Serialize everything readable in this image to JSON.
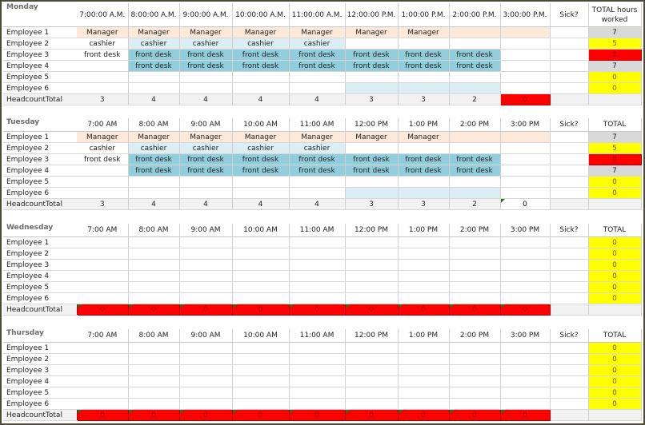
{
  "colors": {
    "mgr": "#fde9d9",
    "cash": "#daeef3",
    "fd": "#92cddc",
    "gray": "#d9d9d9",
    "yellow": "#ffff00",
    "red": "#ff0000"
  },
  "days": [
    {
      "title": "Monday",
      "times": [
        "7:00:00 A.M.",
        "8:00:00 A.M.",
        "9:00:00 A.M.",
        "10:00:00 A.M.",
        "11:00:00 A.M.",
        "12:00:00 P.M.",
        "1:00:00 P.M.",
        "2:00:00 P.M.",
        "3:00:00 P.M."
      ],
      "sick_label": "Sick?",
      "total_label": "TOTAL hours worked",
      "rows": [
        {
          "name": "Employee 1",
          "cells": [
            [
              "Manager",
              "mgr"
            ],
            [
              "Manager",
              "mgr"
            ],
            [
              "Manager",
              "mgr"
            ],
            [
              "Manager",
              "mgr"
            ],
            [
              "Manager",
              "mgr"
            ],
            [
              "Manager",
              "mgr"
            ],
            [
              "Manager",
              "mgr"
            ],
            [
              "",
              "mgr"
            ],
            [
              "",
              "mgr"
            ]
          ],
          "total": "7",
          "total_fill": "gray"
        },
        {
          "name": "Employee 2",
          "cells": [
            [
              "cashier",
              ""
            ],
            [
              "cashier",
              "cash"
            ],
            [
              "cashier",
              "cash"
            ],
            [
              "cashier",
              "cash"
            ],
            [
              "cashier",
              "cash"
            ],
            [
              "",
              ""
            ],
            [
              "",
              ""
            ],
            [
              "",
              ""
            ],
            [
              "",
              ""
            ]
          ],
          "total": "5",
          "total_fill": "yellow"
        },
        {
          "name": "Employee 3",
          "cells": [
            [
              "front desk",
              ""
            ],
            [
              "front desk",
              "fd"
            ],
            [
              "front desk",
              "fd"
            ],
            [
              "front desk",
              "fd"
            ],
            [
              "front desk",
              "fd"
            ],
            [
              "front desk",
              "fd"
            ],
            [
              "front desk",
              "fd"
            ],
            [
              "front desk",
              "fd"
            ],
            [
              "",
              ""
            ]
          ],
          "total": "8",
          "total_fill": "red"
        },
        {
          "name": "Employee 4",
          "cells": [
            [
              "",
              ""
            ],
            [
              "front desk",
              "fd"
            ],
            [
              "front desk",
              "fd"
            ],
            [
              "front desk",
              "fd"
            ],
            [
              "front desk",
              "fd"
            ],
            [
              "front desk",
              "fd"
            ],
            [
              "front desk",
              "fd"
            ],
            [
              "front desk",
              "fd"
            ],
            [
              "",
              ""
            ]
          ],
          "total": "7",
          "total_fill": "gray"
        },
        {
          "name": "Employee 5",
          "cells": [
            [
              "",
              ""
            ],
            [
              "",
              ""
            ],
            [
              "",
              ""
            ],
            [
              "",
              ""
            ],
            [
              "",
              ""
            ],
            [
              "",
              ""
            ],
            [
              "",
              ""
            ],
            [
              "",
              ""
            ],
            [
              "",
              ""
            ]
          ],
          "total": "0",
          "total_fill": "yellow"
        },
        {
          "name": "Employee 6",
          "cells": [
            [
              "",
              ""
            ],
            [
              "",
              ""
            ],
            [
              "",
              ""
            ],
            [
              "",
              ""
            ],
            [
              "",
              ""
            ],
            [
              "",
              "cash"
            ],
            [
              "",
              "cash"
            ],
            [
              "",
              "cash"
            ],
            [
              "",
              ""
            ]
          ],
          "total": "0",
          "total_fill": "yellow"
        }
      ],
      "headcount_label": "HeadcountTotal",
      "headcount": [
        [
          "3",
          ""
        ],
        [
          "4",
          ""
        ],
        [
          "4",
          ""
        ],
        [
          "4",
          ""
        ],
        [
          "4",
          ""
        ],
        [
          "3",
          ""
        ],
        [
          "3",
          ""
        ],
        [
          "2",
          ""
        ],
        [
          "0",
          "red"
        ]
      ]
    },
    {
      "title": "Tuesday",
      "times": [
        "7:00 AM",
        "8:00 AM",
        "9:00 AM",
        "10:00 AM",
        "11:00 AM",
        "12:00 PM",
        "1:00 PM",
        "2:00 PM",
        "3:00 PM"
      ],
      "sick_label": "Sick?",
      "total_label": "TOTAL",
      "rows": [
        {
          "name": "Employee 1",
          "cells": [
            [
              "Manager",
              "mgr"
            ],
            [
              "Manager",
              "mgr"
            ],
            [
              "Manager",
              "mgr"
            ],
            [
              "Manager",
              "mgr"
            ],
            [
              "Manager",
              "mgr"
            ],
            [
              "Manager",
              "mgr"
            ],
            [
              "Manager",
              "mgr"
            ],
            [
              "",
              "mgr"
            ],
            [
              "",
              "mgr"
            ]
          ],
          "total": "7",
          "total_fill": "gray"
        },
        {
          "name": "Employee 2",
          "cells": [
            [
              "cashier",
              ""
            ],
            [
              "cashier",
              "cash"
            ],
            [
              "cashier",
              "cash"
            ],
            [
              "cashier",
              "cash"
            ],
            [
              "cashier",
              "cash"
            ],
            [
              "",
              ""
            ],
            [
              "",
              ""
            ],
            [
              "",
              ""
            ],
            [
              "",
              ""
            ]
          ],
          "total": "5",
          "total_fill": "yellow"
        },
        {
          "name": "Employee 3",
          "cells": [
            [
              "front desk",
              ""
            ],
            [
              "front desk",
              "fd"
            ],
            [
              "front desk",
              "fd"
            ],
            [
              "front desk",
              "fd"
            ],
            [
              "front desk",
              "fd"
            ],
            [
              "front desk",
              "fd"
            ],
            [
              "front desk",
              "fd"
            ],
            [
              "front desk",
              "fd"
            ],
            [
              "",
              ""
            ]
          ],
          "total": "8",
          "total_fill": "red"
        },
        {
          "name": "Employee 4",
          "cells": [
            [
              "",
              ""
            ],
            [
              "front desk",
              "fd"
            ],
            [
              "front desk",
              "fd"
            ],
            [
              "front desk",
              "fd"
            ],
            [
              "front desk",
              "fd"
            ],
            [
              "front desk",
              "fd"
            ],
            [
              "front desk",
              "fd"
            ],
            [
              "front desk",
              "fd"
            ],
            [
              "",
              ""
            ]
          ],
          "total": "7",
          "total_fill": "gray"
        },
        {
          "name": "Employee 5",
          "cells": [
            [
              "",
              ""
            ],
            [
              "",
              ""
            ],
            [
              "",
              ""
            ],
            [
              "",
              ""
            ],
            [
              "",
              ""
            ],
            [
              "",
              ""
            ],
            [
              "",
              ""
            ],
            [
              "",
              ""
            ],
            [
              "",
              ""
            ]
          ],
          "total": "0",
          "total_fill": "yellow"
        },
        {
          "name": "Employee 6",
          "cells": [
            [
              "",
              ""
            ],
            [
              "",
              ""
            ],
            [
              "",
              ""
            ],
            [
              "",
              ""
            ],
            [
              "",
              ""
            ],
            [
              "",
              "cash"
            ],
            [
              "",
              "cash"
            ],
            [
              "",
              "cash"
            ],
            [
              "",
              ""
            ]
          ],
          "total": "0",
          "total_fill": "yellow"
        }
      ],
      "headcount_label": "HeadcountTotal",
      "headcount": [
        [
          "3",
          ""
        ],
        [
          "4",
          ""
        ],
        [
          "4",
          ""
        ],
        [
          "4",
          ""
        ],
        [
          "4",
          ""
        ],
        [
          "3",
          ""
        ],
        [
          "3",
          ""
        ],
        [
          "2",
          ""
        ],
        [
          "0",
          "white tri"
        ]
      ]
    },
    {
      "title": "Wednesday",
      "times": [
        "7:00 AM",
        "8:00 AM",
        "9:00 AM",
        "10:00 AM",
        "11:00 AM",
        "12:00 PM",
        "1:00 PM",
        "2:00 PM",
        "3:00 PM"
      ],
      "sick_label": "Sick?",
      "total_label": "TOTAL",
      "rows": [
        {
          "name": "Employee 1",
          "cells": [],
          "total": "0",
          "total_fill": "yellow"
        },
        {
          "name": "Employee 2",
          "cells": [],
          "total": "0",
          "total_fill": "yellow"
        },
        {
          "name": "Employee 3",
          "cells": [],
          "total": "0",
          "total_fill": "yellow"
        },
        {
          "name": "Employee 4",
          "cells": [],
          "total": "0",
          "total_fill": "yellow"
        },
        {
          "name": "Employee 5",
          "cells": [],
          "total": "0",
          "total_fill": "yellow"
        },
        {
          "name": "Employee 6",
          "cells": [],
          "total": "0",
          "total_fill": "yellow"
        }
      ],
      "headcount_label": "HeadcountTotal",
      "headcount": [
        [
          "0",
          "red tri"
        ],
        [
          "0",
          "red tri"
        ],
        [
          "0",
          "red tri"
        ],
        [
          "0",
          "red tri"
        ],
        [
          "0",
          "red tri"
        ],
        [
          "0",
          "red tri"
        ],
        [
          "0",
          "red tri"
        ],
        [
          "0",
          "red tri"
        ],
        [
          "0",
          "red tri"
        ]
      ]
    },
    {
      "title": "Thursday",
      "times": [
        "7:00 AM",
        "8:00 AM",
        "9:00 AM",
        "10:00 AM",
        "11:00 AM",
        "12:00 PM",
        "1:00 PM",
        "2:00 PM",
        "3:00 PM"
      ],
      "sick_label": "Sick?",
      "total_label": "TOTAL",
      "rows": [
        {
          "name": "Employee 1",
          "cells": [],
          "total": "0",
          "total_fill": "yellow"
        },
        {
          "name": "Employee 2",
          "cells": [],
          "total": "0",
          "total_fill": "yellow"
        },
        {
          "name": "Employee 3",
          "cells": [],
          "total": "0",
          "total_fill": "yellow"
        },
        {
          "name": "Employee 4",
          "cells": [],
          "total": "0",
          "total_fill": "yellow"
        },
        {
          "name": "Employee 5",
          "cells": [],
          "total": "0",
          "total_fill": "yellow"
        },
        {
          "name": "Employee 6",
          "cells": [],
          "total": "0",
          "total_fill": "yellow"
        }
      ],
      "headcount_label": "HeadcountTotal",
      "headcount": [
        [
          "0",
          "red tri"
        ],
        [
          "0",
          "red tri"
        ],
        [
          "0",
          "red tri"
        ],
        [
          "0",
          "red tri"
        ],
        [
          "0",
          "red tri"
        ],
        [
          "0",
          "red tri"
        ],
        [
          "0",
          "red tri"
        ],
        [
          "0",
          "red tri"
        ],
        [
          "0",
          "red tri"
        ]
      ]
    }
  ]
}
